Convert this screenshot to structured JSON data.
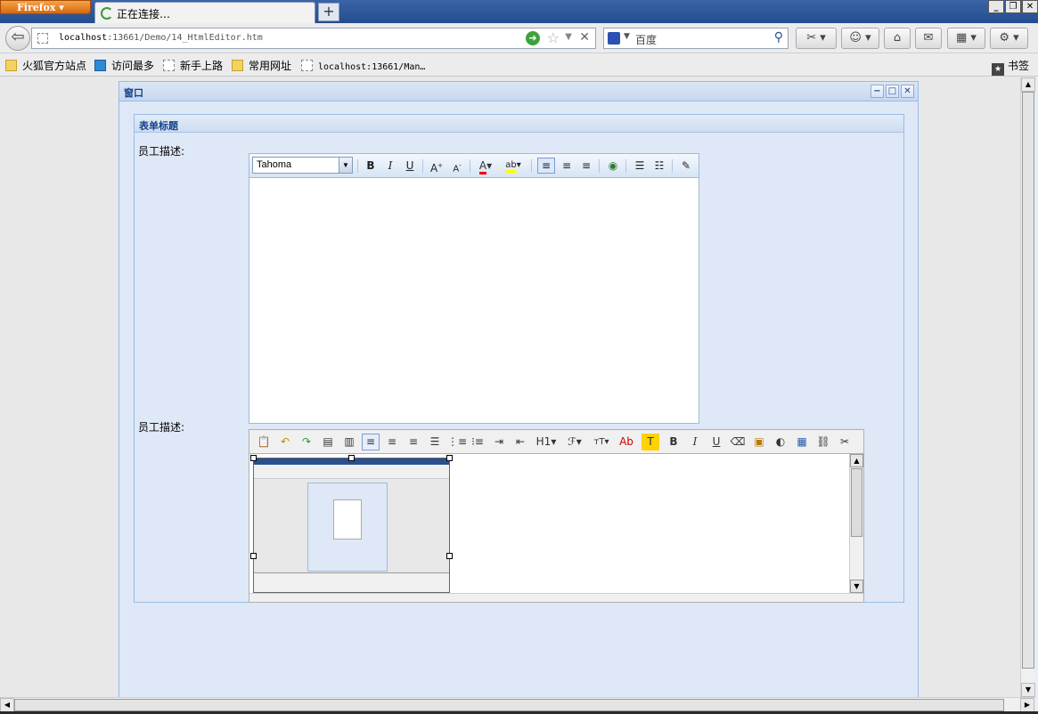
{
  "browser": {
    "app_button": "Firefox",
    "tab_title": "正在连接…",
    "new_tab": "+",
    "url_host": "localhost",
    "url_rest": ":13661/Demo/14_HtmlEditor.htm",
    "search_placeholder": "百度"
  },
  "bookmarks": {
    "items": [
      "火狐官方站点",
      "访问最多",
      "新手上路",
      "常用网址",
      "localhost:13661/Man…"
    ],
    "right_label": "书签"
  },
  "window": {
    "title": "窗口"
  },
  "form": {
    "legend": "表单标题",
    "field1_label": "员工描述:",
    "field2_label": "员工描述:",
    "font_value": "Tahoma"
  },
  "editor1_toolbar": [
    "B",
    "I",
    "U",
    "A↑",
    "A↓",
    "A",
    "ab",
    "left",
    "center",
    "right",
    "link",
    "ol",
    "ul",
    "source"
  ],
  "editor2_toolbar": [
    "paste",
    "undo",
    "redo",
    "paste-text",
    "paste-word",
    "align-left",
    "align-center",
    "align-right",
    "justify",
    "ol",
    "ul",
    "indent",
    "outdent",
    "H1",
    "F",
    "TT",
    "Ab",
    "T",
    "B",
    "I",
    "U",
    "eraser",
    "image",
    "flash",
    "table",
    "link",
    "unlink"
  ]
}
